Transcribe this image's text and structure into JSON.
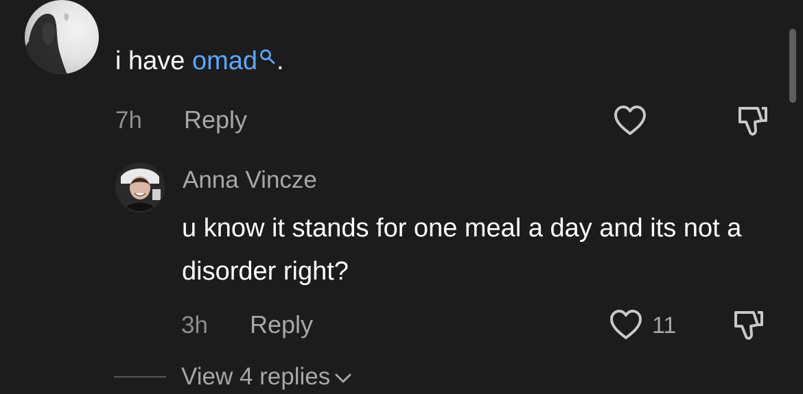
{
  "comment": {
    "text_before": "i have ",
    "link_text": "omad",
    "text_after": ".",
    "time": "7h",
    "reply_label": "Reply"
  },
  "reply": {
    "author": "Anna Vincze",
    "text": "u know it stands for one meal a day and its not a disorder right?",
    "time": "3h",
    "reply_label": "Reply",
    "like_count": "11"
  },
  "view_replies": {
    "label": "View 4 replies"
  },
  "icons": [
    "avatar",
    "search-icon",
    "heart-icon",
    "dislike-icon",
    "chevron-down-icon"
  ],
  "colors": {
    "background": "#1c1c1d",
    "link": "#5aa8ff",
    "secondary_text": "#a7a7ab"
  }
}
